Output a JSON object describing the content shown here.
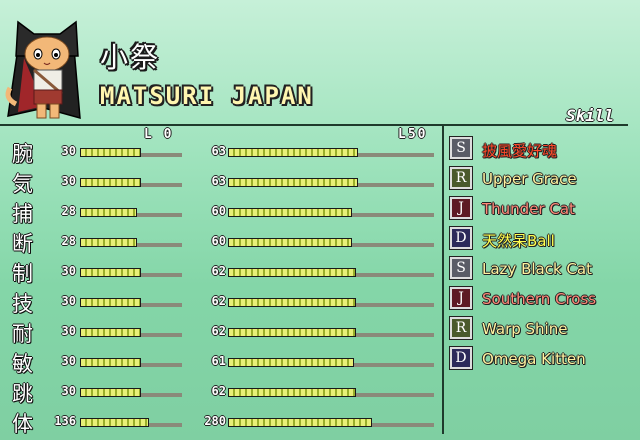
{
  "character": {
    "name_jp": "小祭",
    "name_en": "MATSURI JAPAN"
  },
  "skill_header": "Skill",
  "level_labels": {
    "lv0": "L 0",
    "lv50": "L50"
  },
  "stats": [
    {
      "label": "腕",
      "lv0": "30",
      "lv0_ratio": 0.6,
      "lv50": "63",
      "lv50_ratio": 0.63
    },
    {
      "label": "気",
      "lv0": "30",
      "lv0_ratio": 0.6,
      "lv50": "63",
      "lv50_ratio": 0.63
    },
    {
      "label": "捕",
      "lv0": "28",
      "lv0_ratio": 0.56,
      "lv50": "60",
      "lv50_ratio": 0.6
    },
    {
      "label": "断",
      "lv0": "28",
      "lv0_ratio": 0.56,
      "lv50": "60",
      "lv50_ratio": 0.6
    },
    {
      "label": "制",
      "lv0": "30",
      "lv0_ratio": 0.6,
      "lv50": "62",
      "lv50_ratio": 0.62
    },
    {
      "label": "技",
      "lv0": "30",
      "lv0_ratio": 0.6,
      "lv50": "62",
      "lv50_ratio": 0.62
    },
    {
      "label": "耐",
      "lv0": "30",
      "lv0_ratio": 0.6,
      "lv50": "62",
      "lv50_ratio": 0.62
    },
    {
      "label": "敏",
      "lv0": "30",
      "lv0_ratio": 0.6,
      "lv50": "61",
      "lv50_ratio": 0.61
    },
    {
      "label": "跳",
      "lv0": "30",
      "lv0_ratio": 0.6,
      "lv50": "62",
      "lv50_ratio": 0.62
    },
    {
      "label": "体",
      "lv0": "136",
      "lv0_ratio": 0.68,
      "lv50": "280",
      "lv50_ratio": 0.7
    }
  ],
  "skills": [
    {
      "rank": "S",
      "name": "披風愛好魂",
      "badge_color": "#5a5c66",
      "text_color": "#ff4a2a"
    },
    {
      "rank": "R",
      "name": "Upper Grace",
      "badge_color": "#4a5a2c",
      "text_color": "#fff3a0"
    },
    {
      "rank": "J",
      "name": "Thunder Cat",
      "badge_color": "#5e1a24",
      "text_color": "#ff8878"
    },
    {
      "rank": "D",
      "name": "天然呆Ball",
      "badge_color": "#2c2a5a",
      "text_color": "#ffff50"
    },
    {
      "rank": "S",
      "name": "Lazy Black Cat",
      "badge_color": "#5a5c66",
      "text_color": "#fff3a0"
    },
    {
      "rank": "J",
      "name": "Southern Cross",
      "badge_color": "#5e1a24",
      "text_color": "#ff8878"
    },
    {
      "rank": "R",
      "name": "Warp Shine",
      "badge_color": "#4a5a2c",
      "text_color": "#fff3a0"
    },
    {
      "rank": "D",
      "name": "Omega Kitten",
      "badge_color": "#2c2a5a",
      "text_color": "#fff3a0"
    }
  ]
}
